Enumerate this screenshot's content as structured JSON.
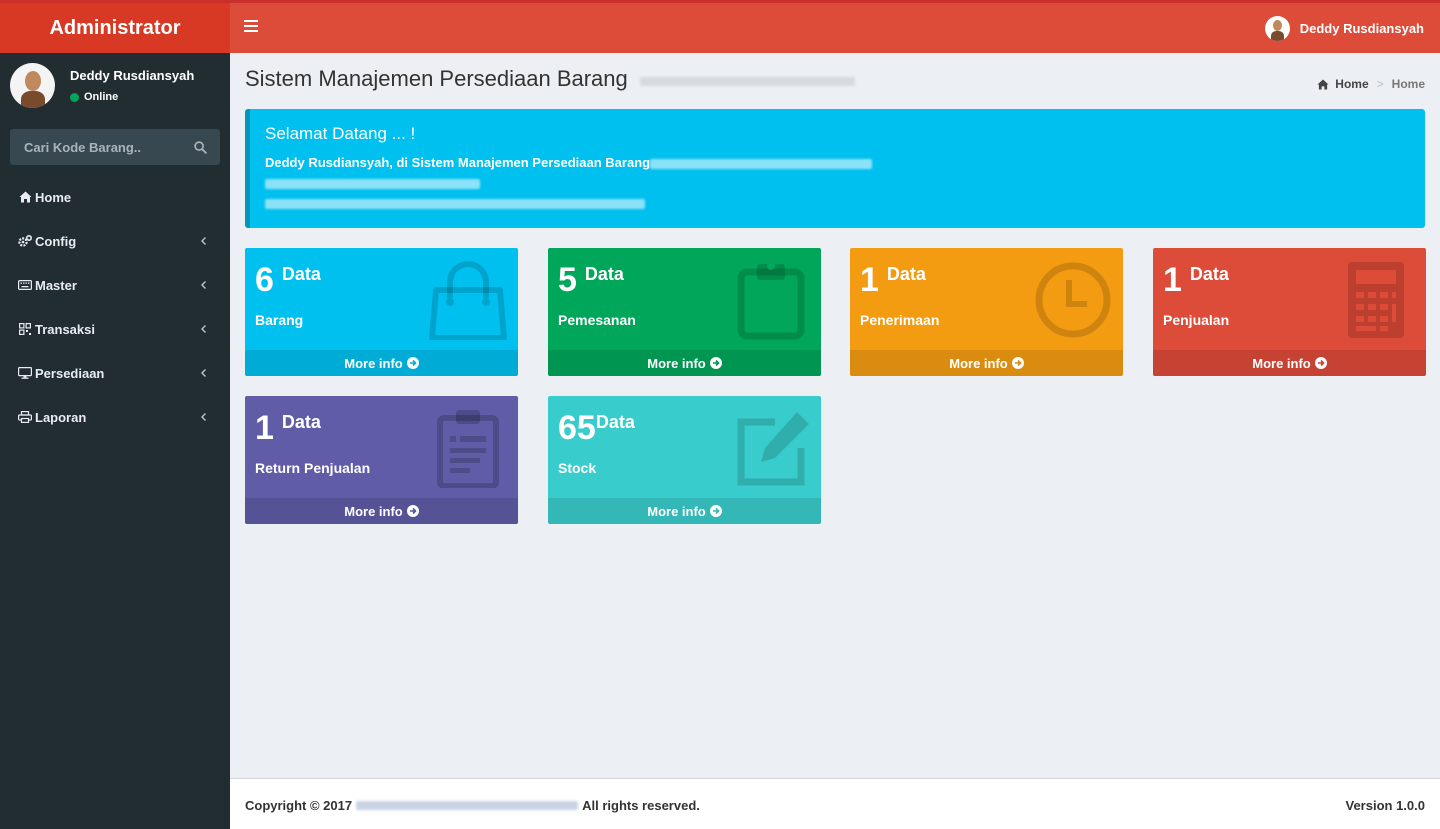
{
  "header": {
    "logo_text": "Administrator",
    "user_name": "Deddy Rusdiansyah"
  },
  "sidebar": {
    "user_name": "Deddy Rusdiansyah",
    "status": "Online",
    "search_placeholder": "Cari Kode Barang..",
    "items": [
      {
        "label": "Home",
        "icon": "home-icon",
        "has_submenu": false
      },
      {
        "label": "Config",
        "icon": "cogs-icon",
        "has_submenu": true
      },
      {
        "label": "Master",
        "icon": "keyboard-icon",
        "has_submenu": true
      },
      {
        "label": "Transaksi",
        "icon": "qrcode-icon",
        "has_submenu": true
      },
      {
        "label": "Persediaan",
        "icon": "desktop-icon",
        "has_submenu": true
      },
      {
        "label": "Laporan",
        "icon": "print-icon",
        "has_submenu": true
      }
    ]
  },
  "content": {
    "title": "Sistem Manajemen Persediaan Barang",
    "breadcrumb": {
      "home": "Home",
      "active": "Home"
    },
    "callout": {
      "heading": "Selamat Datang ... !",
      "line1": "Deddy Rusdiansyah, di Sistem Manajemen Persediaan Barang"
    },
    "boxes": [
      {
        "number": "6",
        "unit": "Data",
        "label": "Barang",
        "footer": "More info",
        "icon": "shopping-bag-icon",
        "color": "#00c0ef"
      },
      {
        "number": "5",
        "unit": "Data",
        "label": "Pemesanan",
        "footer": "More info",
        "icon": "clipboard-icon",
        "color": "#00a65a"
      },
      {
        "number": "1",
        "unit": "Data",
        "label": "Penerimaan",
        "footer": "More info",
        "icon": "clock-icon",
        "color": "#f39c12"
      },
      {
        "number": "1",
        "unit": "Data",
        "label": "Penjualan",
        "footer": "More info",
        "icon": "calculator-icon",
        "color": "#dd4b39"
      },
      {
        "number": "1",
        "unit": "Data",
        "label": "Return Penjualan",
        "footer": "More info",
        "icon": "clipboard-list-icon",
        "color": "#605ca8"
      },
      {
        "number": "65",
        "unit": "Data",
        "label": "Stock",
        "footer": "More info",
        "icon": "edit-icon",
        "color": "#39cccc"
      }
    ]
  },
  "footer": {
    "copyright_prefix": "Copyright © 2017",
    "copyright_suffix": "All rights reserved.",
    "version": "Version 1.0.0"
  }
}
